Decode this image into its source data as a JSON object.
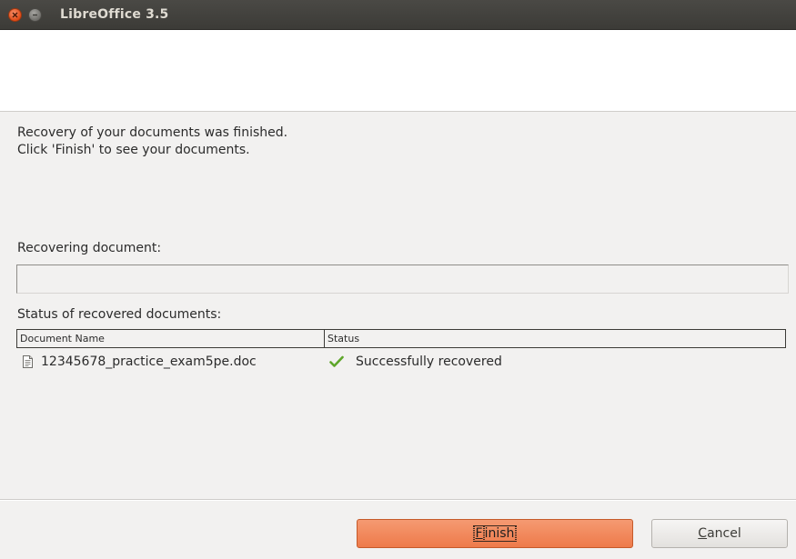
{
  "window": {
    "title": "LibreOffice 3.5"
  },
  "intro": {
    "line1": "Recovery of your documents was finished.",
    "line2": "Click 'Finish' to see your documents."
  },
  "recovering": {
    "label": "Recovering document:",
    "progress_percent": 0
  },
  "status_section": {
    "label": "Status of recovered documents:",
    "columns": [
      "Document Name",
      "Status"
    ],
    "rows": [
      {
        "document_name": "12345678_practice_exam5pe.doc",
        "status": "Successfully recovered",
        "icon": "document-icon",
        "status_icon": "check-icon"
      }
    ]
  },
  "buttons": {
    "finish_accel": "F",
    "finish_rest": "inish",
    "cancel_accel": "C",
    "cancel_rest": "ancel"
  },
  "colors": {
    "accent": "#f07746",
    "titlebar": "#3c3b37",
    "success": "#4e9a06"
  }
}
